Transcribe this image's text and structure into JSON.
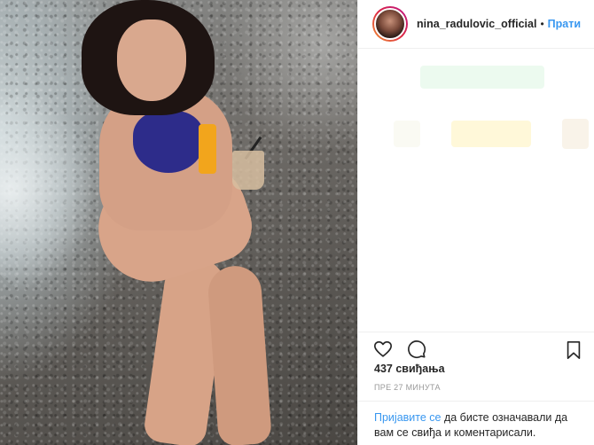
{
  "post": {
    "username": "nina_radulovic_official",
    "separator": "•",
    "follow_label": "Прати",
    "likes": "437 свиђања",
    "timestamp": "ПРЕ 27 МИНУТА",
    "login_link": "Пријавите се",
    "login_text": " да бисте означавали да вам се свиђа и коментарисали."
  },
  "icons": {
    "like": "heart-icon",
    "comment": "comment-icon",
    "save": "bookmark-icon"
  },
  "colors": {
    "accent": "#3897f0",
    "text": "#262626",
    "muted": "#999999",
    "border": "#efefef"
  }
}
